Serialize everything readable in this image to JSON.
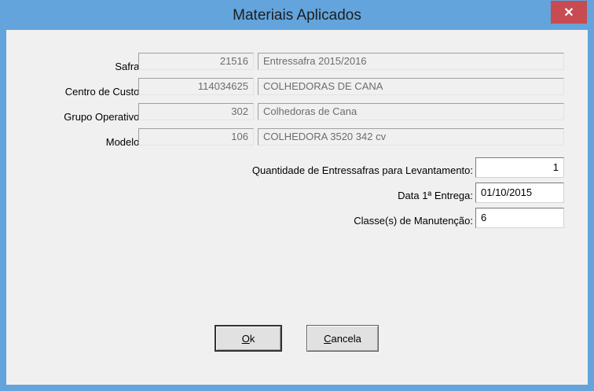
{
  "window": {
    "title": "Materiais Aplicados",
    "close_glyph": "✕"
  },
  "fields": {
    "safra": {
      "label": "Safra:",
      "code": "21516",
      "description": "Entressafra 2015/2016"
    },
    "centro_custo": {
      "label": "Centro de Custo:",
      "code": "114034625",
      "description": "COLHEDORAS DE CANA"
    },
    "grupo_operativo": {
      "label": "Grupo Operativo:",
      "code": "302",
      "description": "Colhedoras de Cana"
    },
    "modelo": {
      "label": "Modelo:",
      "code": "106",
      "description": "COLHEDORA 3520 342 cv"
    }
  },
  "inputs": {
    "quantidade": {
      "label": "Quantidade de Entressafras para Levantamento:",
      "value": "1"
    },
    "data_entrega": {
      "label": "Data 1ª Entrega:",
      "value": "01/10/2015"
    },
    "classes": {
      "label": "Classe(s) de Manutenção:",
      "value": "6"
    }
  },
  "buttons": {
    "ok": {
      "mnemonic": "O",
      "rest": "k"
    },
    "cancel": {
      "mnemonic": "C",
      "rest": "ancela"
    }
  },
  "colors": {
    "frame": "#63a4dc",
    "close": "#c74b50",
    "client": "#f0f0f0"
  }
}
